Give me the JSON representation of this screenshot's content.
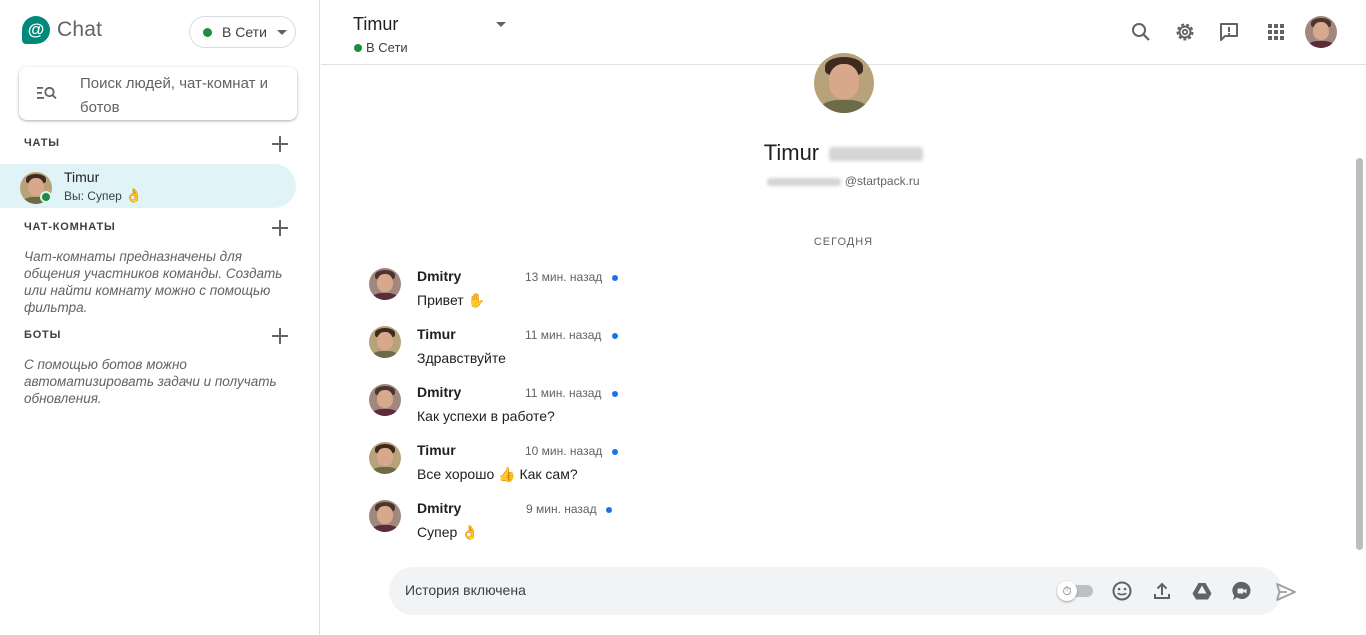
{
  "sidebar": {
    "app_name": "Chat",
    "logo_glyph": "@",
    "status_label": "В Сети",
    "search_placeholder": "Поиск людей, чат-комнат и ботов",
    "sections": {
      "chats": "ЧАТЫ",
      "rooms": "ЧАТ-КОМНАТЫ",
      "bots": "БОТЫ"
    },
    "chat_item": {
      "name": "Timur",
      "snippet": "Вы: Супер",
      "snippet_emoji": "👌"
    },
    "rooms_hint": "Чат-комнаты предназначены для общения участников команды. Создать или найти комнату можно с помощью фильтра.",
    "bots_hint": "С помощью ботов можно автоматизировать задачи и получать обновления."
  },
  "header": {
    "title": "Timur",
    "status": "В Сети",
    "icons": [
      "search-icon",
      "gear-icon",
      "feedback-icon",
      "apps-grid-icon",
      "account-avatar"
    ]
  },
  "profile": {
    "name": "Timur",
    "email_domain": "@startpack.ru"
  },
  "conversation": {
    "day_label": "СЕГОДНЯ",
    "messages": [
      {
        "author": "Dmitry",
        "time": "13 мин. назад",
        "text": "Привет",
        "emoji": "✋"
      },
      {
        "author": "Timur",
        "time": "11 мин. назад",
        "text": "Здравствуйте",
        "emoji": ""
      },
      {
        "author": "Dmitry",
        "time": "11 мин. назад",
        "text": "Как успехи в работе?",
        "emoji": ""
      },
      {
        "author": "Timur",
        "time": "10 мин. назад",
        "text": "Все хорошо",
        "emoji": "👍",
        "text_after": "Как сам?"
      },
      {
        "author": "Dmitry",
        "time": "9 мин. назад",
        "text": "Супер",
        "emoji": "👌"
      }
    ]
  },
  "composer": {
    "placeholder": "История включена",
    "icons": [
      "history-toggle",
      "emoji-icon",
      "upload-icon",
      "drive-icon",
      "meet-icon",
      "send-icon"
    ]
  },
  "colors": {
    "brand": "#00897b",
    "online": "#1e8e3e",
    "selected_chat_bg": "#e0f4f8",
    "read_dot": "#1a73e8"
  }
}
